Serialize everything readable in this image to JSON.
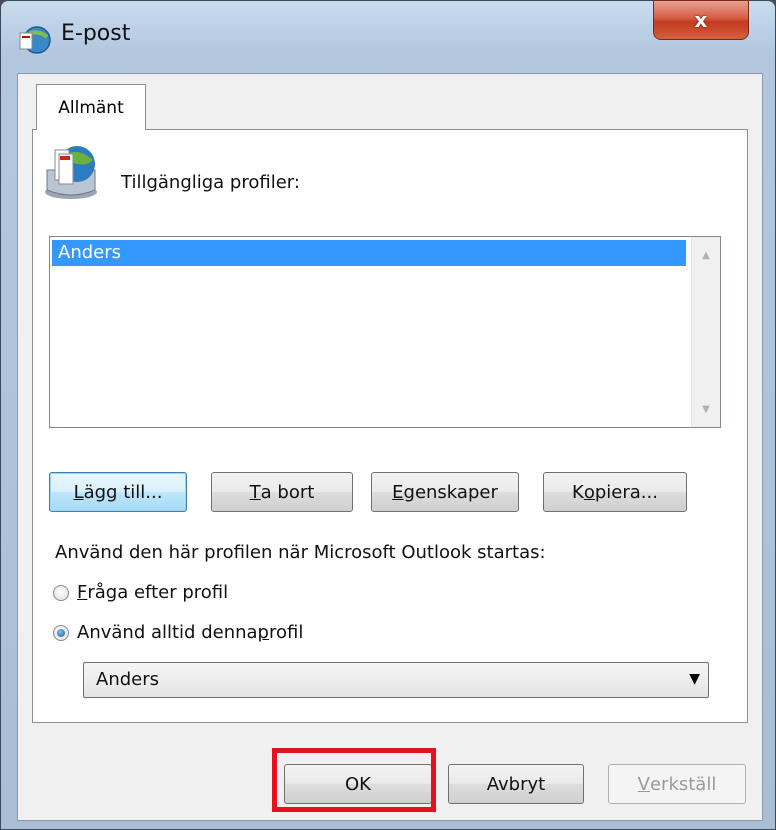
{
  "window": {
    "title": "E-post",
    "close_label": "x"
  },
  "tabs": [
    {
      "label": "Allmänt"
    }
  ],
  "profiles": {
    "label_pre": "Till",
    "label_ul": "g",
    "label_post": "ängliga profiler:",
    "items": [
      "Anders"
    ],
    "selected": "Anders"
  },
  "buttons": {
    "add": {
      "ul": "L",
      "rest": "ägg till..."
    },
    "remove": {
      "ul": "T",
      "rest": "a bort"
    },
    "properties": {
      "ul": "E",
      "rest": "genskaper"
    },
    "copy": {
      "pre": "K",
      "ul": "o",
      "rest": "piera..."
    }
  },
  "startup": {
    "label": "Använd den här profilen när Microsoft Outlook startas:",
    "option_ask": {
      "ul": "F",
      "rest": "råga efter profil",
      "checked": false
    },
    "option_always": {
      "pre": "Använd alltid denna ",
      "ul": "p",
      "rest": "rofil",
      "checked": true
    },
    "combo_value": "Anders"
  },
  "footer": {
    "ok": "OK",
    "cancel": "Avbryt",
    "apply_ul": "V",
    "apply_rest": "erkställ"
  },
  "colors": {
    "selection": "#3399ff",
    "highlight_box": "#e0141e"
  }
}
